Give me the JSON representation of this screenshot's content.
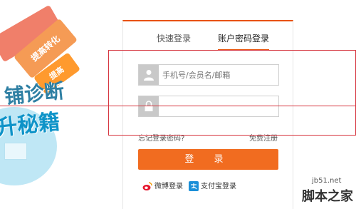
{
  "promo": {
    "tag_line_1": "提高转化",
    "tag_line_2": "提高",
    "headline_1": "铺诊断",
    "headline_2": "升秘籍"
  },
  "login": {
    "tabs": [
      {
        "label": "快速登录"
      },
      {
        "label": "账户密码登录"
      }
    ],
    "username_placeholder": "手机号/会员名/邮箱",
    "password_placeholder": "",
    "forgot_link": "忘记登录密码?",
    "register_link": "免费注册",
    "login_button": "登  录",
    "alt_logins": [
      {
        "label": "微博登录",
        "icon": "weibo-icon"
      },
      {
        "label": "支付宝登录",
        "icon": "alipay-icon"
      }
    ]
  },
  "watermark": {
    "url": "jb51.net",
    "name": "脚本之家"
  },
  "colors": {
    "accent": "#f16c20",
    "annotation_red": "#d6353f"
  }
}
